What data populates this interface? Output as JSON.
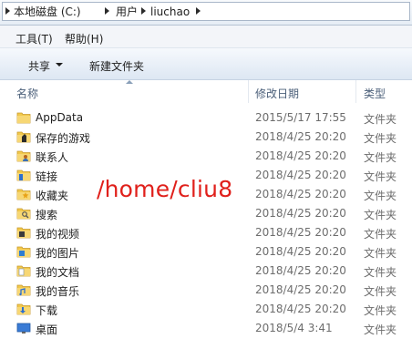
{
  "address": {
    "crumbs": [
      "本地磁盘 (C:)",
      "用户",
      "liuchao"
    ]
  },
  "menu": {
    "tools": "工具(T)",
    "help": "帮助(H)"
  },
  "toolbar": {
    "share": "共享",
    "new_folder": "新建文件夹"
  },
  "columns": {
    "name": "名称",
    "date": "修改日期",
    "type": "类型"
  },
  "files": [
    {
      "name": "AppData",
      "date": "2015/5/17 17:55",
      "type": "文件夹",
      "icon": "folder-icon"
    },
    {
      "name": "保存的游戏",
      "date": "2018/4/25 20:20",
      "type": "文件夹",
      "icon": "saved-games-folder-icon"
    },
    {
      "name": "联系人",
      "date": "2018/4/25 20:20",
      "type": "文件夹",
      "icon": "contacts-folder-icon"
    },
    {
      "name": "链接",
      "date": "2018/4/25 20:20",
      "type": "文件夹",
      "icon": "links-folder-icon"
    },
    {
      "name": "收藏夹",
      "date": "2018/4/25 20:20",
      "type": "文件夹",
      "icon": "favorites-folder-icon"
    },
    {
      "name": "搜索",
      "date": "2018/4/25 20:20",
      "type": "文件夹",
      "icon": "searches-folder-icon"
    },
    {
      "name": "我的视频",
      "date": "2018/4/25 20:20",
      "type": "文件夹",
      "icon": "videos-folder-icon"
    },
    {
      "name": "我的图片",
      "date": "2018/4/25 20:20",
      "type": "文件夹",
      "icon": "pictures-folder-icon"
    },
    {
      "name": "我的文档",
      "date": "2018/4/25 20:20",
      "type": "文件夹",
      "icon": "documents-folder-icon"
    },
    {
      "name": "我的音乐",
      "date": "2018/4/25 20:20",
      "type": "文件夹",
      "icon": "music-folder-icon"
    },
    {
      "name": "下载",
      "date": "2018/4/25 20:20",
      "type": "文件夹",
      "icon": "downloads-folder-icon"
    },
    {
      "name": "桌面",
      "date": "2018/5/4 3:41",
      "type": "文件夹",
      "icon": "desktop-folder-icon"
    }
  ],
  "overlay_text": "/home/cliu8",
  "colors": {
    "overlay": "#e0201b",
    "folder": "#f2c94c",
    "header_text": "#4c607a"
  }
}
